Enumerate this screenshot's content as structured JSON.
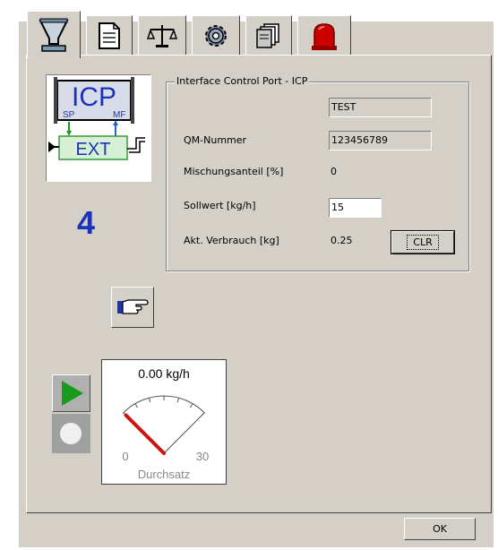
{
  "tabs": [
    {
      "name": "funnel-icon",
      "active": true
    },
    {
      "name": "document-icon",
      "active": false
    },
    {
      "name": "scale-icon",
      "active": false
    },
    {
      "name": "gear-icon",
      "active": false
    },
    {
      "name": "files-icon",
      "active": false
    },
    {
      "name": "alarm-light-icon",
      "active": false
    }
  ],
  "icp_badge": {
    "top_label": "ICP",
    "sp": "SP",
    "mf": "MF",
    "ext": "EXT"
  },
  "station_number": "4",
  "group": {
    "title": "Interface Control Port - ICP",
    "name_value": "TEST",
    "qm_label": "QM-Nummer",
    "qm_value": "123456789",
    "mix_label": "Mischungsanteil [%]",
    "mix_value": "0",
    "setpoint_label": "Sollwert [kg/h]",
    "setpoint_value": "15",
    "consumption_label": "Akt. Verbrauch  [kg]",
    "consumption_value": "0.25",
    "clr_label": "CLR"
  },
  "gauge": {
    "reading": "0.00 kg/h",
    "min": "0",
    "max": "30",
    "caption": "Durchsatz",
    "needle_color": "#cc1111"
  },
  "colors": {
    "accent_blue": "#1a33b8",
    "play_green": "#1a9a1a"
  },
  "footer": {
    "ok_label": "OK"
  }
}
